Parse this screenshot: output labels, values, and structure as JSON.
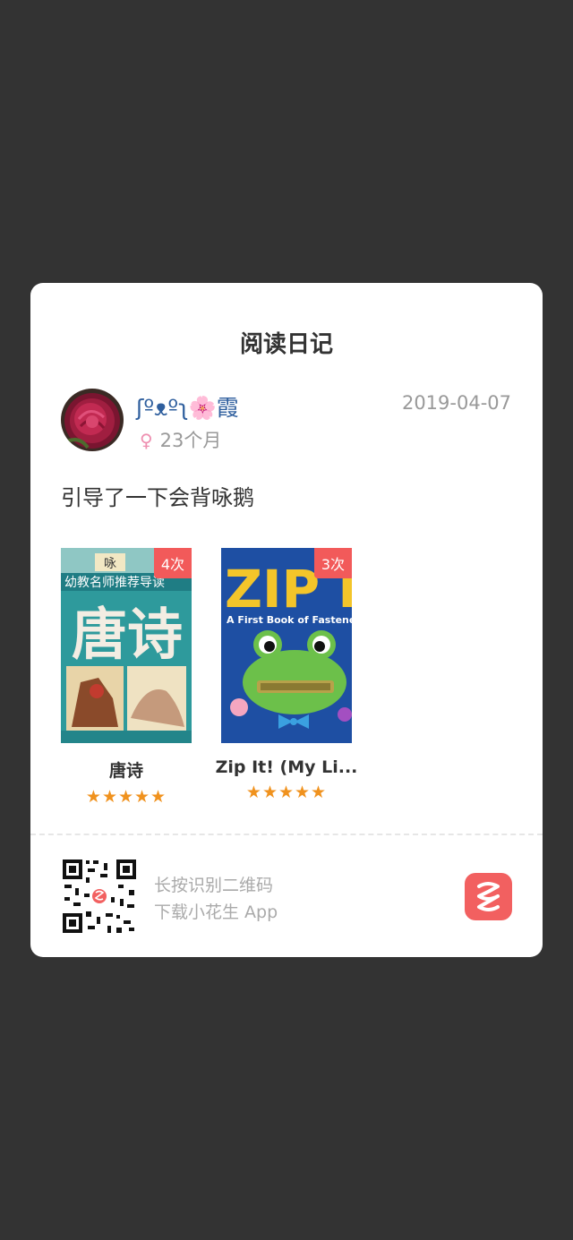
{
  "card": {
    "title": "阅读日记",
    "user": {
      "name": "ʃºᴥºʅ🌸霞",
      "gender_symbol": "♀",
      "age": "23个月"
    },
    "date": "2019-04-07",
    "note": "引导了一下会背咏鹅"
  },
  "books": [
    {
      "title": "唐诗",
      "count": "4次",
      "stars": "★★★★★",
      "rating": 5
    },
    {
      "title": "Zip It! (My Li...",
      "count": "3次",
      "stars": "★★★★★",
      "rating": 5
    }
  ],
  "book_covers": {
    "tangshi": {
      "top_text": "咏",
      "banner_text": "幼教名师推荐导读",
      "big_text": "唐诗"
    },
    "zipit": {
      "big_text": "ZIP IT",
      "subtitle": "A First Book of Fastene"
    }
  },
  "footer": {
    "qr_line1": "长按识别二维码",
    "qr_line2": "下载小花生 App"
  },
  "colors": {
    "background": "#333333",
    "card": "#ffffff",
    "badge": "#f25a5a",
    "star": "#f0921e",
    "username": "#2f5f9e",
    "app_logo": "#f26060"
  },
  "icons": {
    "gender": "female-icon",
    "app": "app-logo-icon",
    "qr": "qr-code-icon"
  }
}
